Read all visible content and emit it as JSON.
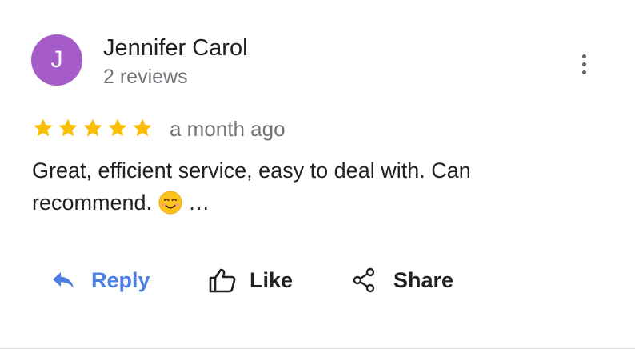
{
  "review": {
    "author_initial": "J",
    "author_name": "Jennifer Carol",
    "review_count": "2 reviews",
    "rating": 5,
    "max_rating": 5,
    "date": "a month ago",
    "text_line1": "Great, efficient service, easy to deal with. Can",
    "text_line2_pre": "recommend.",
    "text_line2_post": "…",
    "emoji_icon": "smiling-face-emoji"
  },
  "actions": {
    "reply_label": "Reply",
    "like_label": "Like",
    "share_label": "Share"
  },
  "colors": {
    "avatar": "#a55cc9",
    "star": "#fbbc04",
    "reply_accent": "#4d7ee6",
    "secondary_text": "#70757a"
  },
  "icons": {
    "more": "more-vertical-icon",
    "reply": "reply-arrow-icon",
    "like": "thumbs-up-icon",
    "share": "share-icon",
    "star": "star-icon"
  }
}
